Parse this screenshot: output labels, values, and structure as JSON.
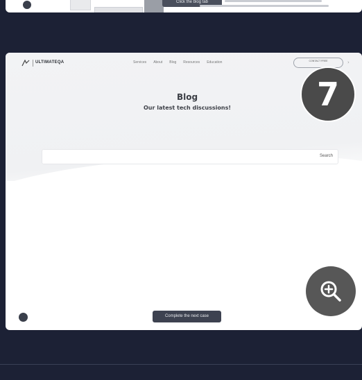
{
  "previous_step": {
    "caption": "Click the blog tab"
  },
  "screenshot": {
    "nav": {
      "logo_text": "ULTIMATEQA",
      "links": [
        "Services",
        "About",
        "Blog",
        "Resources",
        "Education"
      ],
      "cta": "CONTACT FREE"
    },
    "hero": {
      "title": "Blog",
      "subtitle": "Our latest tech discussions!"
    },
    "search": {
      "button_label": "Search"
    },
    "step_number": "7",
    "caption": "Complete the next case"
  },
  "icons": {
    "zoom": "zoom-in-icon",
    "logo": "logo-icon"
  },
  "colors": {
    "page_background": "#1c2135",
    "step_badge": "#4a4a4a",
    "zoom_button": "#575757",
    "caption_background": "#3d4250"
  }
}
